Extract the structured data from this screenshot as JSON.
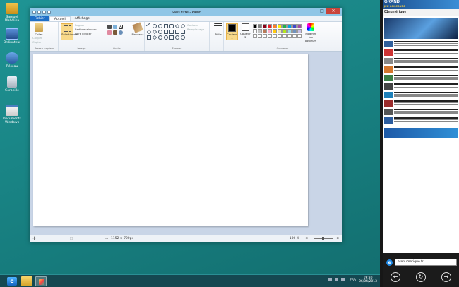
{
  "desktop": {
    "icons": [
      {
        "label": "Samuel Mahélina",
        "kind": "user"
      },
      {
        "label": "Ordinateur",
        "kind": "pc"
      },
      {
        "label": "Réseau",
        "kind": "network"
      },
      {
        "label": "Corbeille",
        "kind": "recycle-bin"
      },
      {
        "label": "Documents Windows",
        "kind": "folder"
      }
    ]
  },
  "paint": {
    "title": "Sans titre - Paint",
    "tabs": [
      "Fichier",
      "Accueil",
      "Affichage"
    ],
    "active_tab": "Accueil",
    "groups": {
      "clipboard": {
        "label": "Presse-papiers",
        "paste": "Coller",
        "cut": "Couper",
        "copy": "Copier"
      },
      "image": {
        "label": "Image",
        "select": "Sélectionner",
        "crop": "Rogner",
        "resize": "Redimensionner",
        "rotate": "Faire pivoter"
      },
      "tools": {
        "label": "Outils"
      },
      "brushes": {
        "label": "Pinceaux"
      },
      "shapes": {
        "label": "Formes",
        "outline": "Contour",
        "fill": "Remplissage"
      },
      "size": {
        "label": "Taille"
      },
      "colors": {
        "label": "Couleurs",
        "color1": "Couleur 1",
        "color2": "Couleur 2",
        "edit": "Modifier les couleurs"
      }
    },
    "palette": [
      "#000000",
      "#7f7f7f",
      "#880015",
      "#ed1c24",
      "#ff7f27",
      "#fff200",
      "#22b14c",
      "#00a2e8",
      "#3f48cc",
      "#a349a4",
      "#ffffff",
      "#c3c3c3",
      "#b97a57",
      "#ffaec9",
      "#ffc90e",
      "#efe4b0",
      "#b5e61d",
      "#99d9ea",
      "#7092be",
      "#c8bfe7",
      "#ffffff",
      "#ffffff",
      "#ffffff",
      "#ffffff",
      "#ffffff",
      "#ffffff",
      "#ffffff",
      "#ffffff",
      "#ffffff",
      "#ffffff"
    ],
    "status": {
      "dimensions": "1152 × 720px",
      "zoom": "100 %"
    }
  },
  "browser": {
    "ad_big": "GRAND",
    "ad_small": "JEU CONCOURS",
    "site_name": "01numérique",
    "address": "erenumerique.fr"
  },
  "taskbar": {
    "lang": "FRA",
    "time": "19:30",
    "date": "06/04/2013"
  }
}
